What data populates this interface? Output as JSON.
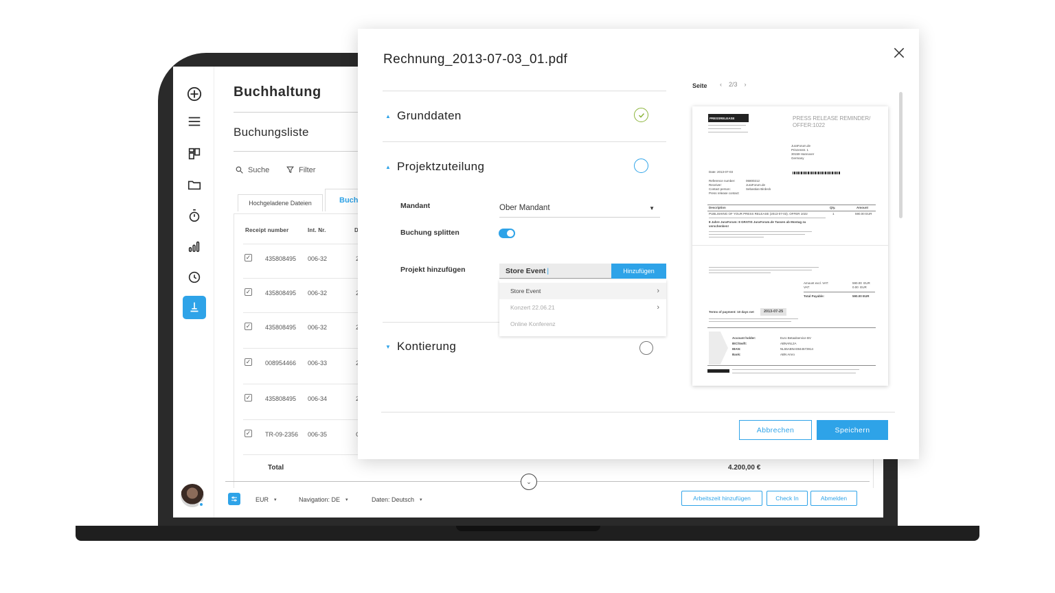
{
  "app": {
    "title": "Buchhaltung",
    "subtitle": "Buchungsliste"
  },
  "toolbar": {
    "search_label": "Suche",
    "filter_label": "Filter"
  },
  "tabs": {
    "uploaded": "Hochgeladene Dateien",
    "active_partial": "Buch"
  },
  "table": {
    "headers": {
      "receipt": "Receipt number",
      "int_nr": "Int. Nr.",
      "next": "D"
    },
    "rows": [
      {
        "receipt": "435808495",
        "int_nr": "006-32",
        "next": "2"
      },
      {
        "receipt": "435808495",
        "int_nr": "006-32",
        "next": "2"
      },
      {
        "receipt": "435808495",
        "int_nr": "006-32",
        "next": "2"
      },
      {
        "receipt": "008954466",
        "int_nr": "006-33",
        "next": "2"
      },
      {
        "receipt": "435808495",
        "int_nr": "006-34",
        "next": "2"
      },
      {
        "receipt": "TR-09-2356",
        "int_nr": "006-35",
        "next": "C"
      }
    ],
    "total_label": "Total",
    "total_value": "4.200,00 €"
  },
  "bottom_bar": {
    "currency": "EUR",
    "navigation": "Navigation: DE",
    "data_lang": "Daten: Deutsch",
    "btn_worktime": "Arbeitszeit hinzufügen",
    "btn_checkin": "Check In",
    "btn_logout": "Abmelden"
  },
  "modal": {
    "title": "Rechnung_2013-07-03_01.pdf",
    "sections": {
      "grunddaten": "Grunddaten",
      "projekt": "Projektzuteilung",
      "kontierung": "Kontierung"
    },
    "fields": {
      "mandant_label": "Mandant",
      "mandant_value": "Ober Mandant",
      "split_label": "Buchung splitten",
      "projekt_label": "Projekt hinzufügen",
      "projekt_value": "Store Event",
      "projekt_add": "Hinzufügen"
    },
    "dropdown": [
      "Store Event",
      "Konzert 22.06.21",
      "Online Konferenz"
    ],
    "preview": {
      "page_label": "Seite",
      "page_indicator": "2/3"
    },
    "buttons": {
      "cancel": "Abbrechen",
      "save": "Speichern"
    },
    "accent_color": "#2ea3e8",
    "success_color": "#8bb43a"
  },
  "doc": {
    "logo": "PRESSRELEASE",
    "heading": "PRESS RELEASE REMINDER/ OFFER:1022",
    "address": "JuraForum.de\nPrinzenstr. 1\n30159 Hannover\nGermany",
    "meta_left": "Reference number:\nReceiver:\nContact person:\nPress release contact:",
    "meta_right": "06800212\nJuraForum.de\nSebastian Birdeck",
    "date_line": "Date:    2013-07-03",
    "col_desc": "Description",
    "col_qty": "Qty.",
    "col_amount": "Amount",
    "item_line": "PUBLISHING OF YOUR PRESS RELEASE (2013-07-03). OFFER 1022",
    "item_qty": "1",
    "item_amount": "590.00 EUR",
    "item_bold": "8 Jahre JuraForum: 8 GRATIS JuraForum.de Tassen ab Montag zu verschenken!",
    "sum_labels": "Amount excl. VAT:\nVAT:",
    "sum_values": "590.00  EUR\n0.00  EUR",
    "total_label": "Total Payable:",
    "total_value": "590.00  EUR",
    "terms": "Terms of payment: 10 days net",
    "due": "2013-07-25",
    "bank_labels": "Account holder:\nBIC/Swift:\nIBAN:\nBank:",
    "bank_values": "Euro Betaalservice BV\nABNANL2A\nNL55ABNA0844573914\nABN Amro"
  }
}
